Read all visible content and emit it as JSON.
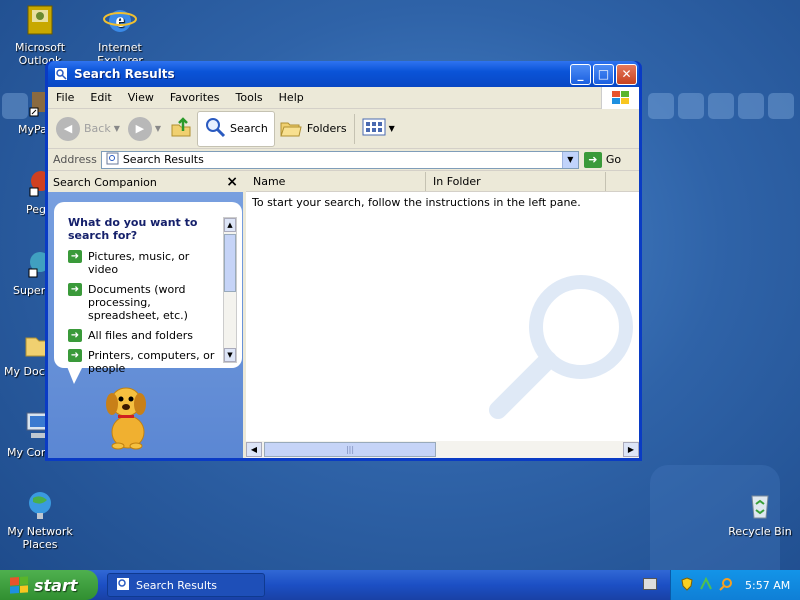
{
  "desktop": {
    "icons": [
      {
        "name": "Microsoft Outlook",
        "line1": "Microsoft",
        "line2": "Outlook"
      },
      {
        "name": "Internet Explorer",
        "line1": "Internet",
        "line2": "Explorer"
      },
      {
        "name": "MyPa",
        "line1": "MyPa",
        "line2": ""
      },
      {
        "name": "Peg",
        "line1": "Peg",
        "line2": ""
      },
      {
        "name": "Superm",
        "line1": "Superm",
        "line2": ""
      },
      {
        "name": "My Docu",
        "line1": "My Docu",
        "line2": ""
      },
      {
        "name": "My Com",
        "line1": "My Com",
        "line2": ""
      },
      {
        "name": "My Network Places",
        "line1": "My Network",
        "line2": "Places"
      },
      {
        "name": "Recycle Bin",
        "line1": "Recycle Bin",
        "line2": ""
      }
    ]
  },
  "window": {
    "title": "Search Results",
    "buttons": {
      "minimize": "_",
      "maximize": "□",
      "close": "✕"
    }
  },
  "menubar": {
    "items": [
      "File",
      "Edit",
      "View",
      "Favorites",
      "Tools",
      "Help"
    ]
  },
  "toolbar": {
    "back_label": "Back",
    "search_label": "Search",
    "folders_label": "Folders"
  },
  "addressbar": {
    "label": "Address",
    "value": "Search Results",
    "go_label": "Go"
  },
  "search_companion": {
    "header": "Search Companion",
    "close": "×",
    "question": "What do you want to search for?",
    "options": [
      "Pictures, music, or video",
      "Documents (word processing, spreadsheet, etc.)",
      "All files and folders",
      "Printers, computers, or people"
    ]
  },
  "results": {
    "columns": [
      "Name",
      "In Folder"
    ],
    "message": "To start your search, follow the instructions in the left pane."
  },
  "taskbar": {
    "start_label": "start",
    "task_label": "Search Results",
    "clock": "5:57 AM"
  },
  "colors": {
    "title_bar": "#0b54d8",
    "taskbar": "#1c4fc4",
    "start_button": "#318f31",
    "tray": "#0f7fd6",
    "search_pane": "#6b95da"
  }
}
